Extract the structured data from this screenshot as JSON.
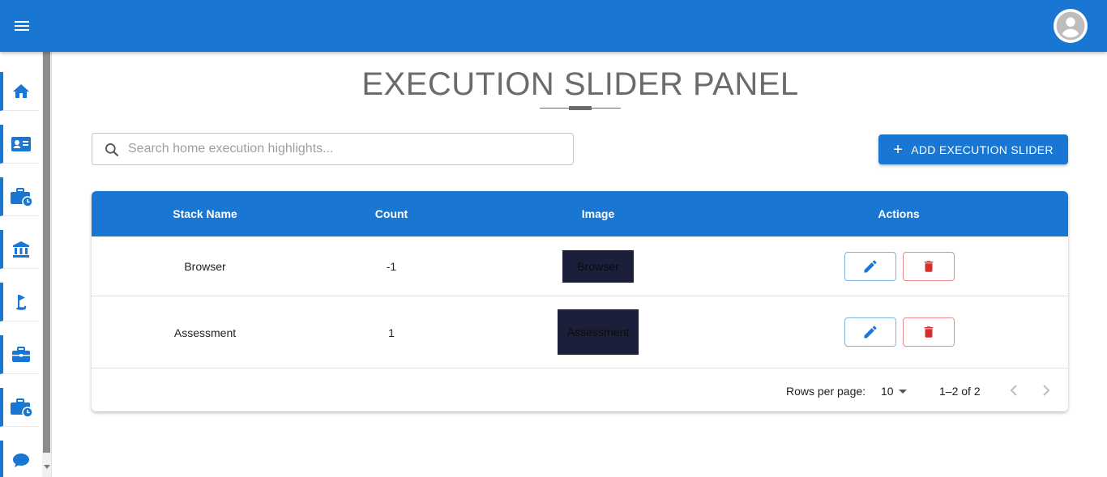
{
  "header": {
    "menu_icon": "menu-icon",
    "avatar_icon": "account-circle-icon"
  },
  "sidebar": {
    "items": [
      {
        "name": "home",
        "icon": "home-icon"
      },
      {
        "name": "contact-card",
        "icon": "id-card-icon"
      },
      {
        "name": "briefcase-clock",
        "icon": "briefcase-clock-icon"
      },
      {
        "name": "institution",
        "icon": "bank-icon"
      },
      {
        "name": "golf",
        "icon": "golf-flag-icon"
      },
      {
        "name": "briefcase",
        "icon": "briefcase-icon"
      },
      {
        "name": "briefcase-clock-2",
        "icon": "briefcase-clock-icon"
      },
      {
        "name": "chat",
        "icon": "chat-bubble-icon"
      }
    ]
  },
  "page": {
    "title": "EXECUTION SLIDER PANEL"
  },
  "search": {
    "placeholder": "Search home execution highlights...",
    "value": ""
  },
  "toolbar": {
    "add_label": "ADD EXECUTION SLIDER"
  },
  "table": {
    "columns": [
      "Stack Name",
      "Count",
      "Image",
      "Actions"
    ],
    "rows": [
      {
        "stack_name": "Browser",
        "count": "-1",
        "image_alt": "Browser"
      },
      {
        "stack_name": "Assessment",
        "count": "1",
        "image_alt": "Assessment"
      }
    ]
  },
  "pagination": {
    "rows_per_page_label": "Rows per page:",
    "rows_per_page": "10",
    "range": "1–2 of 2"
  },
  "colors": {
    "primary": "#1976d2",
    "danger": "#d32f2f",
    "title_gray": "#6b6b6b"
  }
}
